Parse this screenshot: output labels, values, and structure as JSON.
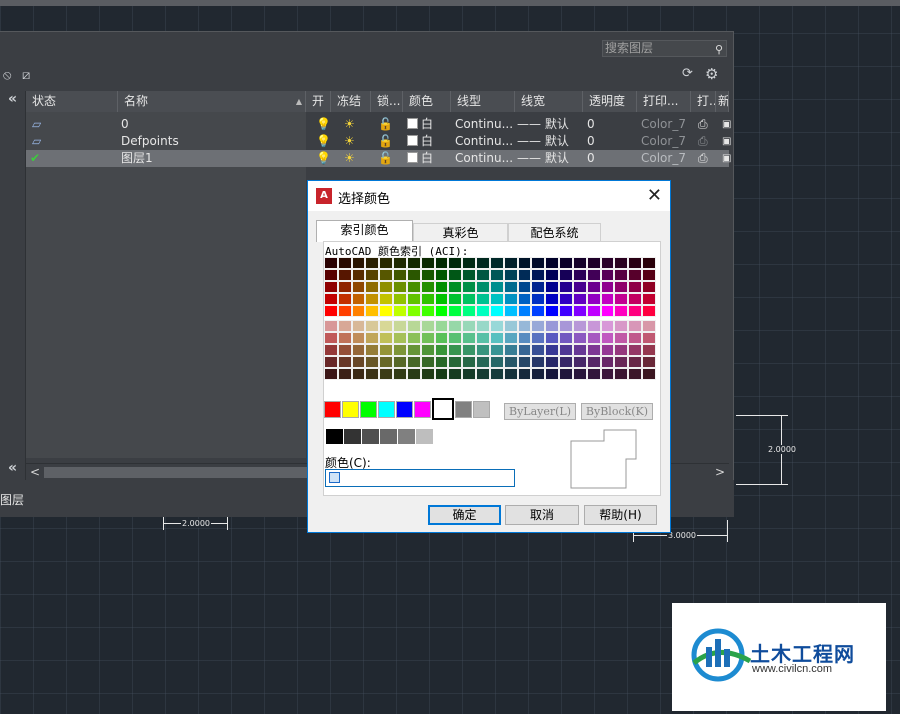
{
  "palette": {
    "search_placeholder": "搜索图层",
    "panel_title": "图层",
    "columns": [
      "状态",
      "名称",
      "开",
      "冻结",
      "锁...",
      "颜色",
      "线型",
      "线宽",
      "透明度",
      "打印...",
      "打...",
      "新"
    ],
    "layers": [
      {
        "name": "0",
        "color": "白",
        "linetype": "Continu...",
        "lineweight": "—— 默认",
        "transparency": "0",
        "plotstyle": "Color_7"
      },
      {
        "name": "Defpoints",
        "color": "白",
        "linetype": "Continu...",
        "lineweight": "—— 默认",
        "transparency": "0",
        "plotstyle": "Color_7"
      },
      {
        "name": "图层1",
        "color": "白",
        "linetype": "Continu...",
        "lineweight": "—— 默认",
        "transparency": "0",
        "plotstyle": "Color_7"
      }
    ]
  },
  "drawing": {
    "dim_horizontal_left": "2.0000",
    "dim_horizontal_right": "3.0000",
    "dim_vertical": "2.0000"
  },
  "dialog": {
    "title": "选择颜色",
    "tabs": [
      "索引颜色",
      "真彩色",
      "配色系统"
    ],
    "aci_label": "AutoCAD 颜色索引 (ACI):",
    "bylayer_label": "ByLayer(L)",
    "byblock_label": "ByBlock(K)",
    "color_field_label": "颜色(C):",
    "color_field_value": "",
    "ok_label": "确定",
    "cancel_label": "取消",
    "help_label": "帮助(H)",
    "standard_colors": [
      "#ff0000",
      "#ffff00",
      "#00ff00",
      "#00ffff",
      "#0000ff",
      "#ff00ff",
      "#ffffff",
      "#808080",
      "#c0c0c0"
    ],
    "gray_colors": [
      "#000000",
      "#333333",
      "#505050",
      "#696969",
      "#808080",
      "#bebebe",
      "#ffffff"
    ]
  },
  "watermark": {
    "brand": "土木工程网",
    "url": "www.civilcn.com"
  }
}
